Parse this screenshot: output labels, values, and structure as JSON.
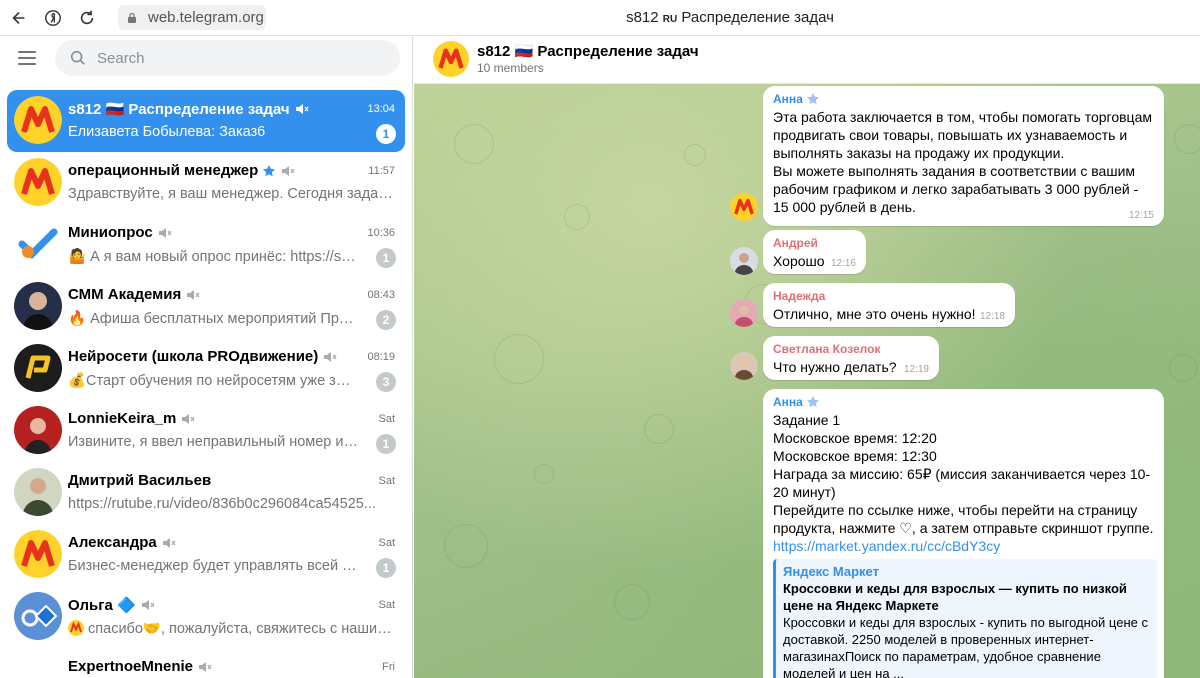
{
  "browser": {
    "url": "web.telegram.org",
    "tab_title_prefix": "s812",
    "tab_title_flag": "RU",
    "tab_title_suffix": "Распределение задач"
  },
  "search": {
    "placeholder": "Search"
  },
  "chats": [
    {
      "title": "s812 🇷🇺 Распределение задач",
      "time": "13:04",
      "preview": "Елизавета Бобылева: Заказ6",
      "badge": "1",
      "active": true
    },
    {
      "title": "операционный менеджер",
      "time": "11:57",
      "preview": "Здравствуйте, я ваш менеджер. Сегодня задани...",
      "badge": ""
    },
    {
      "title": "Миниопрос",
      "time": "10:36",
      "preview": "🤷 А я вам новый опрос принёс: https://surve...",
      "badge": "1"
    },
    {
      "title": "СММ Академия",
      "time": "08:43",
      "preview": "🔥 Афиша бесплатных мероприятий Привет, ...",
      "badge": "2"
    },
    {
      "title": "Нейросети (школа PROдвижение)",
      "time": "08:19",
      "preview": "💰Старт обучения по нейросетям уже завтра!...",
      "badge": "3"
    },
    {
      "title": "LonnieKeira_m",
      "time": "Sat",
      "preview": "Извините, я ввел неправильный номер из-за ...",
      "badge": "1"
    },
    {
      "title": "Дмитрий Васильев",
      "time": "Sat",
      "preview": "https://rutube.ru/video/836b0c296084ca54525...",
      "badge": ""
    },
    {
      "title": "Александра",
      "time": "Sat",
      "preview": "Бизнес-менеджер будет управлять всей ваш...",
      "badge": "1"
    },
    {
      "title": "Ольга 🔷",
      "time": "Sat",
      "preview": "спасибо🤝, пожалуйста, свяжитесь с нашим ...",
      "badge": ""
    },
    {
      "title": "ExpertnoeMnenie",
      "time": "Fri",
      "preview": "",
      "badge": ""
    }
  ],
  "header": {
    "title": "s812 🇷🇺 Распределение задач",
    "subtitle": "10 members"
  },
  "messages": {
    "m1": {
      "author": "Анна",
      "text": "Эта работа заключается в том, чтобы помогать торговцам продвигать свои товары, повышать их узнаваемость и выполнять заказы на продажу их продукции.\nВы можете выполнять задания в соответствии с вашим рабочим графиком и легко зарабатывать 3 000 рублей - 15 000 рублей в день.",
      "time": "12:15"
    },
    "m2": {
      "author": "Андрей",
      "text": "Хорошо",
      "time": "12:16"
    },
    "m3": {
      "author": "Надежда",
      "text": "Отлично, мне это очень нужно!",
      "time": "12:18"
    },
    "m4": {
      "author": "Светлана Козелок",
      "text": "Что нужно делать?",
      "time": "12:19"
    },
    "m5": {
      "author": "Анна",
      "text": "Задание 1\nМосковское время: 12:20\nМосковское время: 12:30\nНаграда за миссию: 65₽ (миссия заканчивается через 10-20 минут)\nПерейдите по ссылке ниже, чтобы перейти на страницу продукта, нажмите ♡, а затем отправьте скриншот группе.",
      "link": "https://market.yandex.ru/cc/cBdY3cy",
      "preview_site": "Яндекс Маркет",
      "preview_title": "Кроссовки и кеды для взрослых — купить по низкой цене на Яндекс Маркете",
      "preview_desc": "Кроссовки и кеды для взрослых - купить по выгодной цене с доставкой. 2250 моделей в проверенных интернет-магазинахПоиск по параметрам, удобное сравнение моделей и цен на ..."
    }
  },
  "colors": {
    "accent": "#3390ec",
    "author_anna": "#3390ec",
    "author_andrey": "#e17076",
    "author_nadezhda": "#e17076",
    "author_svetlana": "#e17076"
  }
}
